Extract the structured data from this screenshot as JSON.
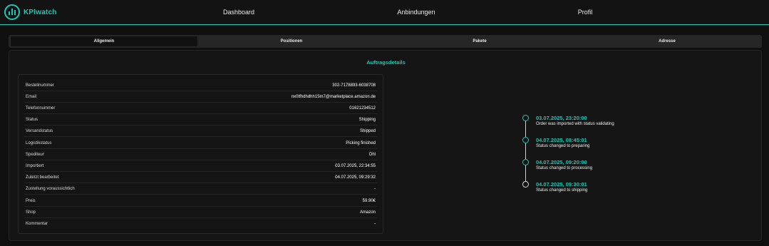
{
  "brand": {
    "name": "KPIwatch",
    "accent_color": "#1fc7b4"
  },
  "nav": {
    "items": [
      {
        "label": "Dashboard"
      },
      {
        "label": "Anbindungen"
      },
      {
        "label": "Profil"
      }
    ]
  },
  "tabs": {
    "items": [
      {
        "label": "Allgemein",
        "active": true
      },
      {
        "label": "Positionen",
        "active": false
      },
      {
        "label": "Pakete",
        "active": false
      },
      {
        "label": "Adresse",
        "active": false
      }
    ]
  },
  "order": {
    "title": "Auftragsdetails",
    "fields": [
      {
        "label": "Bestellnummer",
        "value": "302-7178893-6038708"
      },
      {
        "label": "Email",
        "value": "nx0tfhdhdhh15m7@marketplace.amazon.de"
      },
      {
        "label": "Telefonnummer",
        "value": "01621234512"
      },
      {
        "label": "Status",
        "value": "Shipping"
      },
      {
        "label": "Versandstatus",
        "value": "Shipped"
      },
      {
        "label": "Logistikstatus",
        "value": "Picking finished"
      },
      {
        "label": "Spediteur",
        "value": "Dhl"
      },
      {
        "label": "Importiert",
        "value": "03.07.2025, 22:34:55"
      },
      {
        "label": "Zuletzt bearbeitet",
        "value": "04.07.2025, 09:29:32"
      },
      {
        "label": "Zustellung voraussichtlich",
        "value": "-"
      },
      {
        "label": "Preis",
        "value": "59.90€"
      },
      {
        "label": "Shop",
        "value": "Amazon"
      },
      {
        "label": "Kommentar",
        "value": "-"
      }
    ]
  },
  "timeline": {
    "events": [
      {
        "date": "03.07.2025, 23:20:00",
        "text": "Order was imported with status validating"
      },
      {
        "date": "04.07.2025, 08:45:01",
        "text": "Status changed to preparing"
      },
      {
        "date": "04.07.2025, 09:20:00",
        "text": "Status changed to processing"
      },
      {
        "date": "04.07.2025, 09:30:01",
        "text": "Status changed to shipping"
      }
    ]
  }
}
